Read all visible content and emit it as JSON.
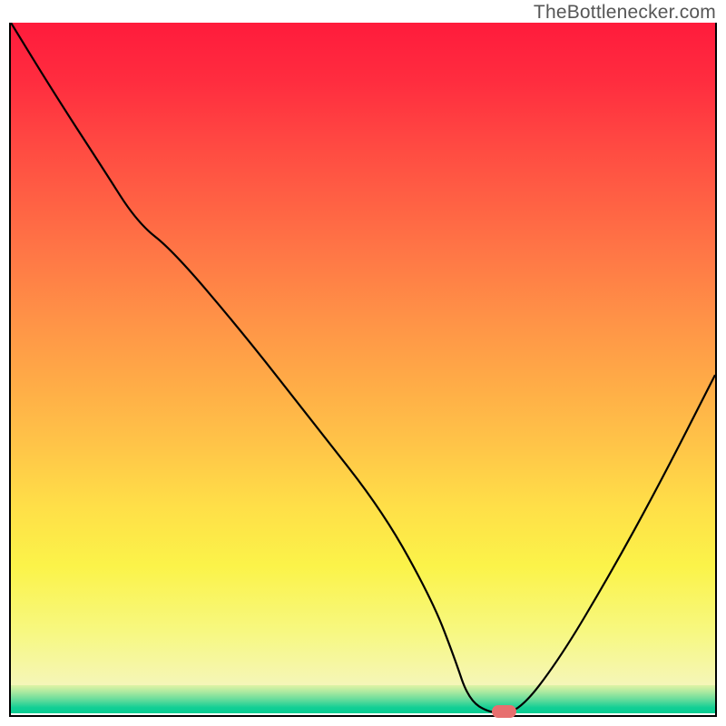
{
  "watermark": "TheBottleneсker.com",
  "colors": {
    "gradient_top": "#ff1b3c",
    "gradient_mid": "#ffc548",
    "gradient_bottom": "#f5f6b8",
    "green_band_start": "#dff3a5",
    "green_band_end": "#09cd92",
    "curve": "#000000",
    "marker": "#e76f6f",
    "frame": "#000000"
  },
  "chart_data": {
    "type": "line",
    "title": "",
    "xlabel": "",
    "ylabel": "",
    "xlim": [
      0,
      100
    ],
    "ylim": [
      0,
      100
    ],
    "series": [
      {
        "name": "bottleneck-curve",
        "x": [
          0,
          6,
          13,
          18,
          23,
          33,
          43,
          53,
          60,
          63,
          65,
          68,
          72,
          78,
          85,
          92,
          100
        ],
        "values": [
          100,
          90,
          79,
          71,
          67,
          55,
          42,
          29,
          16,
          8,
          2,
          0,
          0,
          8,
          20,
          33,
          49
        ]
      }
    ],
    "marker": {
      "x": 70,
      "y": 0,
      "width_pct": 3.5
    },
    "background": "rainbow-heat-gradient"
  }
}
